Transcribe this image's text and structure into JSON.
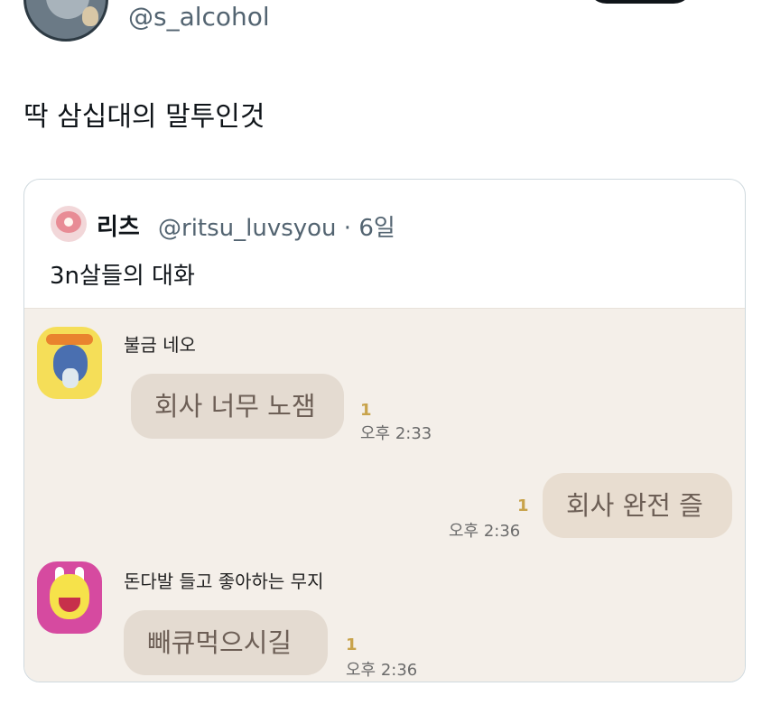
{
  "tweet": {
    "handle": "@s_alcohol",
    "text": "딱 삼십대의 말투인것"
  },
  "quote": {
    "name": "리츠",
    "handle_time": "@ritsu_luvsyou · 6일",
    "text": "3n살들의 대화"
  },
  "chat": {
    "messages": [
      {
        "sender": "불금 네오",
        "text": "회사 너무 노잼",
        "unread": "1",
        "time": "오후 2:33"
      },
      {
        "sender": "",
        "text": "회사 완전 즐",
        "unread": "1",
        "time": "오후 2:36"
      },
      {
        "sender": "돈다발 들고 좋아하는 무지",
        "text": "빼큐먹으시길",
        "unread": "1",
        "time": "오후 2:36"
      }
    ]
  },
  "colors": {
    "chat_bg": "#f4efe9",
    "bubble": "#e4dbd1",
    "unread": "#c8a34b",
    "secondary_text": "#536471"
  }
}
